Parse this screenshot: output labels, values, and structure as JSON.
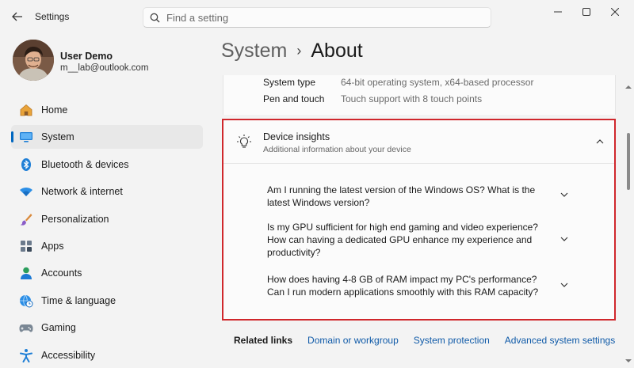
{
  "window": {
    "title": "Settings",
    "controls": [
      "minimize",
      "maximize",
      "close"
    ]
  },
  "search": {
    "placeholder": "Find a setting"
  },
  "user": {
    "name": "User Demo",
    "email": "m__lab@outlook.com"
  },
  "sidebar": {
    "items": [
      {
        "label": "Home",
        "icon": "home-icon",
        "active": false
      },
      {
        "label": "System",
        "icon": "system-icon",
        "active": true
      },
      {
        "label": "Bluetooth & devices",
        "icon": "bluetooth-icon",
        "active": false
      },
      {
        "label": "Network & internet",
        "icon": "wifi-icon",
        "active": false
      },
      {
        "label": "Personalization",
        "icon": "brush-icon",
        "active": false
      },
      {
        "label": "Apps",
        "icon": "apps-icon",
        "active": false
      },
      {
        "label": "Accounts",
        "icon": "accounts-icon",
        "active": false
      },
      {
        "label": "Time & language",
        "icon": "globe-clock-icon",
        "active": false
      },
      {
        "label": "Gaming",
        "icon": "gamepad-icon",
        "active": false
      },
      {
        "label": "Accessibility",
        "icon": "accessibility-icon",
        "active": false
      }
    ]
  },
  "breadcrumb": {
    "parent": "System",
    "separator": "›",
    "current": "About"
  },
  "specs": [
    {
      "label": "System type",
      "value": "64-bit operating system, x64-based processor"
    },
    {
      "label": "Pen and touch",
      "value": "Touch support with 8 touch points"
    }
  ],
  "insights": {
    "title": "Device insights",
    "subtitle": "Additional information about your device",
    "questions": [
      {
        "text": "Am I running the latest version of the Windows OS? What is the latest Windows version?"
      },
      {
        "text": "Is my GPU sufficient for high end gaming and video experience? How can having a dedicated GPU enhance my experience and productivity?"
      },
      {
        "text": "How does having 4-8 GB of RAM impact my PC's performance? Can I run modern applications smoothly with this RAM capacity?"
      }
    ]
  },
  "related": {
    "label": "Related links",
    "links": [
      "Domain or workgroup",
      "System protection",
      "Advanced system settings"
    ]
  },
  "colors": {
    "accent": "#0067c0",
    "highlight_border": "#d0272c",
    "link": "#0f5aa8"
  }
}
